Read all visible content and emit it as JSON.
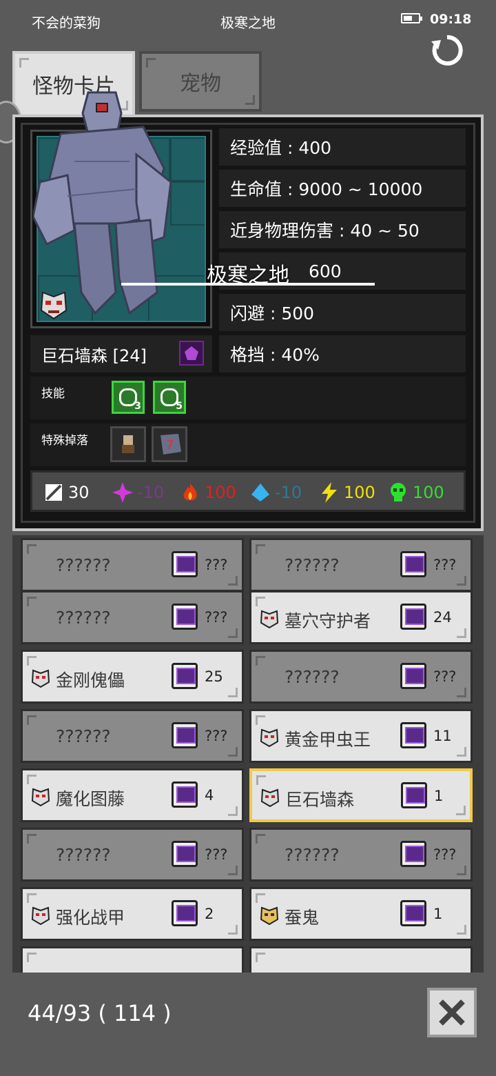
{
  "status_bar": {
    "left_text": "不会的菜狗",
    "center_text": "极寒之地",
    "time": "09:18"
  },
  "tabs": [
    {
      "label": "怪物卡片",
      "active": true
    },
    {
      "label": "宠物",
      "active": false
    }
  ],
  "overlay_title": "极寒之地",
  "monster": {
    "name": "巨石墙森 [24]",
    "stats": [
      {
        "label": "经验值 : 400"
      },
      {
        "label": "生命值 : 9000 ~ 10000"
      },
      {
        "label": "近身物理伤害 : 40 ~ 50"
      },
      {
        "label": "600"
      },
      {
        "label": "闪避 : 500"
      },
      {
        "label": "格挡 : 40%"
      }
    ],
    "skills_label": "技能",
    "skills": [
      {
        "level": "3"
      },
      {
        "level": "5"
      }
    ],
    "drops_label": "特殊掉落",
    "resists": [
      {
        "icon": "armor-icon",
        "value": "30",
        "color": "#ffffff"
      },
      {
        "icon": "arcane-icon",
        "value": "-10",
        "color": "#7a3a8a"
      },
      {
        "icon": "fire-icon",
        "value": "100",
        "color": "#e02020"
      },
      {
        "icon": "ice-icon",
        "value": "-10",
        "color": "#2a7a9a"
      },
      {
        "icon": "lightning-icon",
        "value": "100",
        "color": "#f0e000"
      },
      {
        "icon": "poison-icon",
        "value": "100",
        "color": "#33dd33"
      }
    ]
  },
  "cards": [
    {
      "name": "??????",
      "count": "???",
      "state": "unknown"
    },
    {
      "name": "??????",
      "count": "???",
      "state": "unknown"
    },
    {
      "name": "??????",
      "count": "???",
      "state": "unknown"
    },
    {
      "name": "墓穴守护者",
      "count": "24",
      "state": "known"
    },
    {
      "name": "金刚傀儡",
      "count": "25",
      "state": "known"
    },
    {
      "name": "??????",
      "count": "???",
      "state": "unknown"
    },
    {
      "name": "??????",
      "count": "???",
      "state": "unknown"
    },
    {
      "name": "黄金甲虫王",
      "count": "11",
      "state": "known"
    },
    {
      "name": "魔化图藤",
      "count": "4",
      "state": "known"
    },
    {
      "name": "巨石墙森",
      "count": "1",
      "state": "selected"
    },
    {
      "name": "??????",
      "count": "???",
      "state": "unknown"
    },
    {
      "name": "??????",
      "count": "???",
      "state": "unknown"
    },
    {
      "name": "强化战甲",
      "count": "2",
      "state": "known"
    },
    {
      "name": "蚕鬼",
      "count": "1",
      "state": "known"
    }
  ],
  "footer": {
    "collection_count": "44/93 ( 114 )"
  }
}
